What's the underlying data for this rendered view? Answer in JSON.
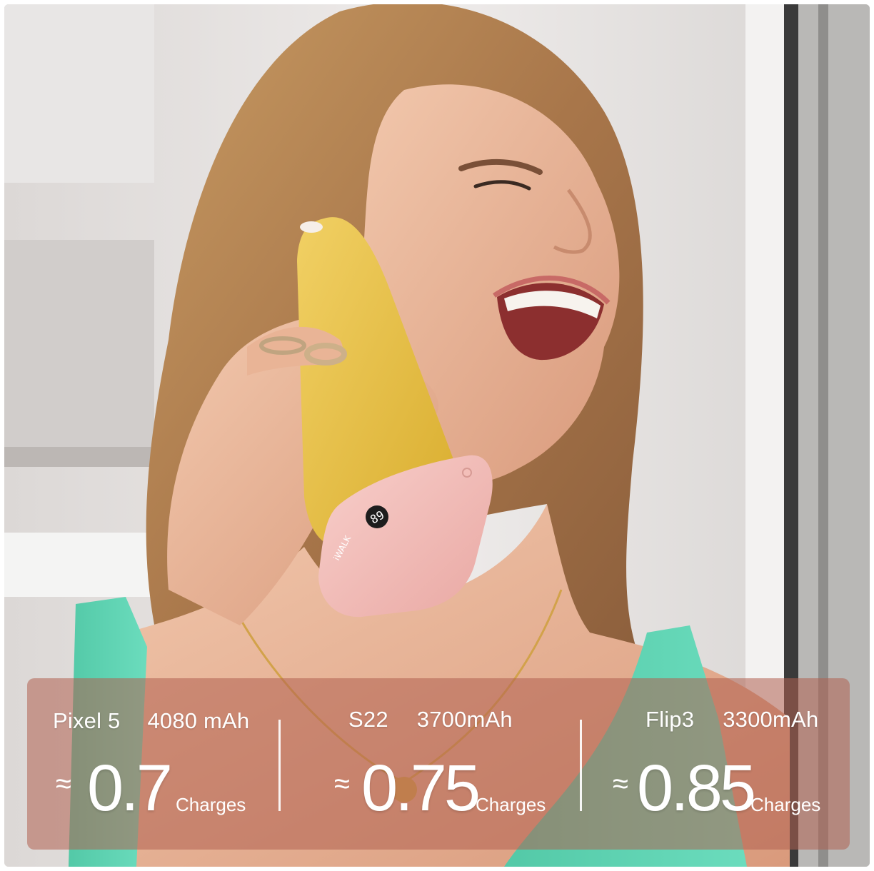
{
  "stats": [
    {
      "device": "Pixel 5",
      "capacity": "4080 mAh",
      "approx": "≈",
      "charges": "0.7",
      "unit": "Charges"
    },
    {
      "device": "S22",
      "capacity": "3700mAh",
      "approx": "≈",
      "charges": "0.75",
      "unit": "Charges"
    },
    {
      "device": "Flip3",
      "capacity": "3300mAh",
      "approx": "≈",
      "charges": "0.85",
      "unit": "Charges"
    }
  ],
  "product": {
    "brand_mark": "iWALK",
    "display_reading": "89"
  },
  "colors": {
    "overlay": "#b06050",
    "phone": "#e6be3c",
    "power_bank": "#f0b8b4",
    "top": "#5fd6b2"
  }
}
